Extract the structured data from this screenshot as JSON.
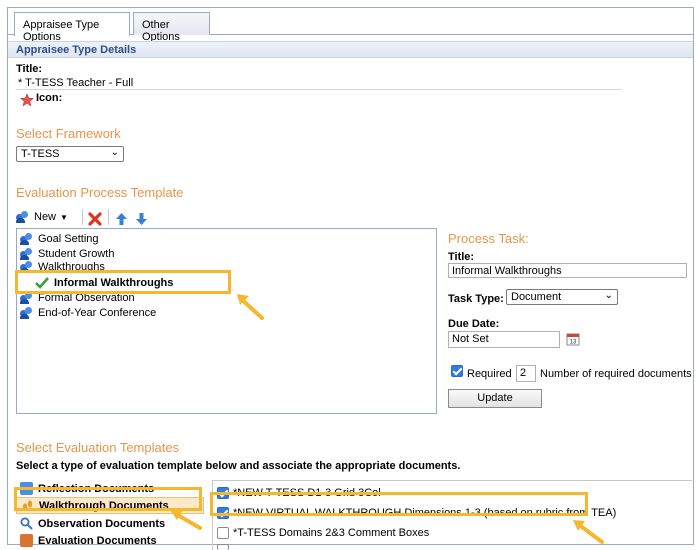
{
  "tabs": [
    {
      "label": "Appraisee Type Options",
      "active": true
    },
    {
      "label": "Other Options",
      "active": false
    }
  ],
  "section_header": "Appraisee Type Details",
  "title_field": {
    "label": "Title:",
    "value": "* T-TESS Teacher - Full"
  },
  "icon_label": "Icon:",
  "framework": {
    "heading": "Select Framework",
    "selected": "T-TESS"
  },
  "process_template": {
    "heading": "Evaluation Process Template",
    "toolbar": {
      "new_label": "New"
    },
    "items": [
      "Goal Setting",
      "Student Growth",
      "Walkthroughs",
      "Formal Observation",
      "End-of-Year Conference"
    ],
    "sub_item": "Informal Walkthroughs"
  },
  "process_task": {
    "heading": "Process Task:",
    "title_label": "Title:",
    "title_value": "Informal Walkthroughs",
    "task_type_label": "Task Type:",
    "task_type_value": "Document",
    "due_date_label": "Due Date:",
    "due_date_value": "Not Set",
    "required_label": "Required",
    "required_count": "2",
    "required_count_label": "Number of required documents",
    "update_label": "Update"
  },
  "eval_templates": {
    "heading": "Select Evaluation Templates",
    "instruction": "Select a type of evaluation template below and associate the appropriate documents.",
    "types": [
      "Reflection Documents",
      "Walkthrough Documents",
      "Observation Documents",
      "Evaluation Documents"
    ],
    "selected_type": "Walkthrough Documents",
    "documents": [
      {
        "label": "*NEW T-TESS D1-3 Grid 3Col",
        "checked": true
      },
      {
        "label": "*NEW VIRTUAL WALKTHROUGH Dimensions 1-3 (based on rubric from TEA)",
        "checked": true
      },
      {
        "label": "*T-TESS Domains 2&3 Comment Boxes",
        "checked": false
      }
    ]
  },
  "colors": {
    "accent_orange": "#e8954a",
    "highlight": "#f5b72d",
    "header_blue": "#2c4f86",
    "check_blue": "#2f7de1"
  }
}
